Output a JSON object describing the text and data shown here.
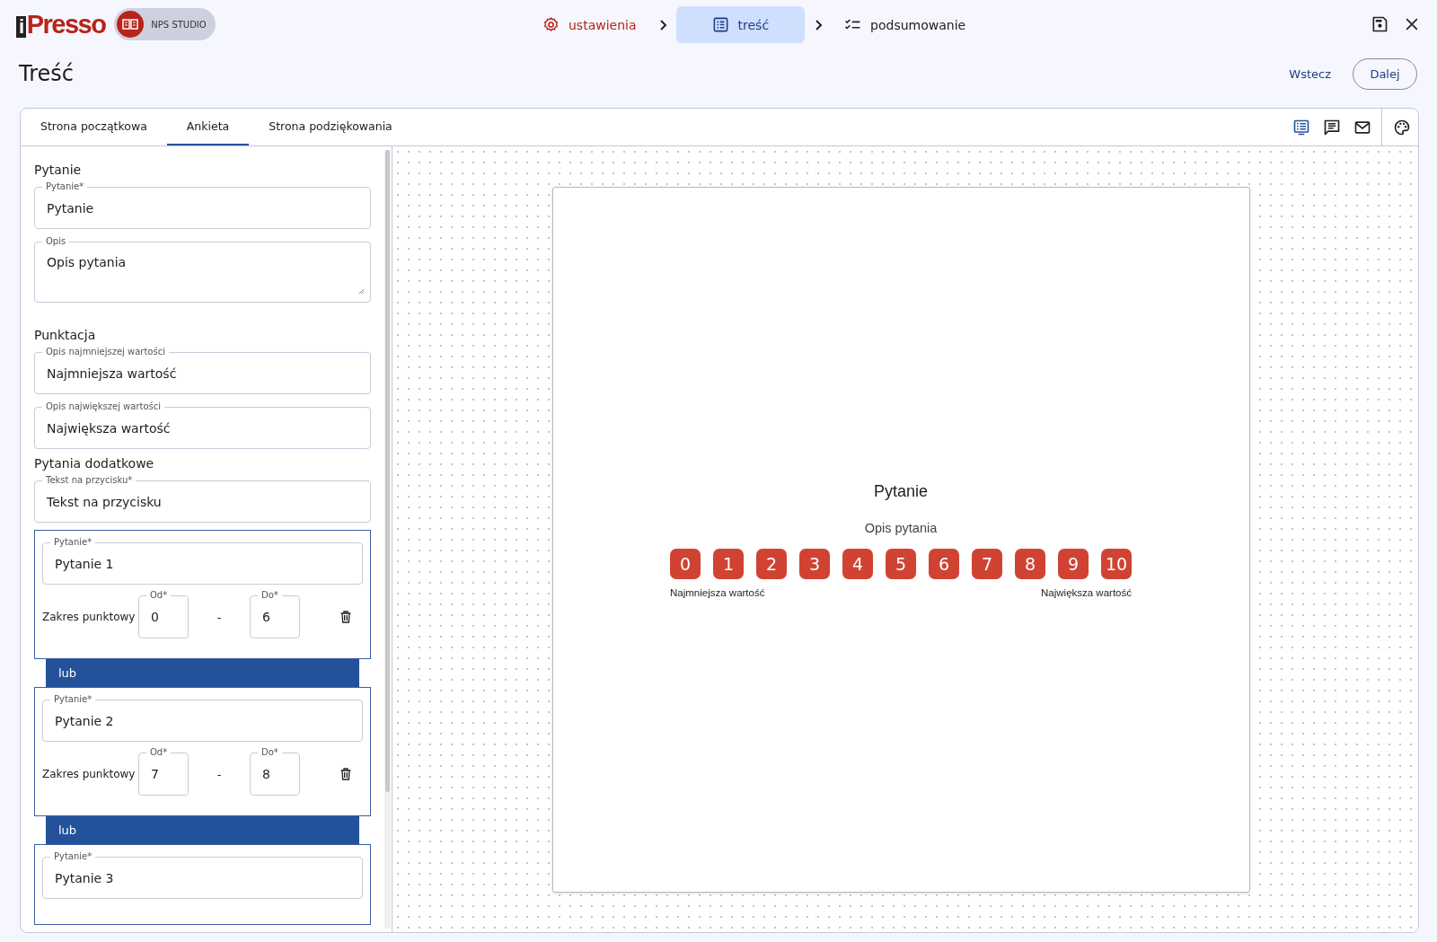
{
  "header": {
    "logo_mark": "i",
    "logo_text": "Presso",
    "badge": "NPS STUDIO",
    "steps": [
      {
        "label": "ustawienia",
        "kind": "settings",
        "selected": false,
        "done": true
      },
      {
        "label": "treść",
        "kind": "list",
        "selected": true,
        "done": false
      },
      {
        "label": "podsumowanie",
        "kind": "checklist",
        "selected": false,
        "done": false
      }
    ]
  },
  "page": {
    "title": "Treść",
    "back": "Wstecz",
    "next": "Dalej"
  },
  "tabs": [
    {
      "label": "Strona początkowa",
      "selected": false
    },
    {
      "label": "Ankieta",
      "selected": true
    },
    {
      "label": "Strona podziękowania",
      "selected": false
    }
  ],
  "toolbar": [
    {
      "kind": "form",
      "selected": true
    },
    {
      "kind": "comment",
      "selected": false
    },
    {
      "kind": "mail",
      "selected": false
    },
    {
      "kind": "palette",
      "selected": false
    }
  ],
  "editor": {
    "sections": [
      {
        "title": "Pytanie",
        "fields": [
          {
            "label": "Pytanie*",
            "value": "Pytanie",
            "kind": "input"
          },
          {
            "label": "Opis",
            "value": "Opis pytania",
            "kind": "textarea"
          }
        ]
      },
      {
        "title": "Punktacja",
        "fields": [
          {
            "label": "Opis najmniejszej wartości",
            "value": "Najmniejsza wartość",
            "kind": "input"
          },
          {
            "label": "Opis największej wartości",
            "value": "Największa wartość",
            "kind": "input"
          }
        ]
      },
      {
        "title": "Pytania dodatkowe",
        "fields": [
          {
            "label": "Tekst na przycisku*",
            "value": "Tekst na przycisku",
            "kind": "input"
          }
        ]
      }
    ],
    "extra_questions": [
      {
        "label": "Pytanie*",
        "value": "Pytanie 1",
        "range_label": "Zakres punktowy",
        "from_label": "Od*",
        "from": "0",
        "dash": "-",
        "to_label": "Do*",
        "to": "6",
        "separator": "lub"
      },
      {
        "label": "Pytanie*",
        "value": "Pytanie 2",
        "range_label": "Zakres punktowy",
        "from_label": "Od*",
        "from": "7",
        "dash": "-",
        "to_label": "Do*",
        "to": "8",
        "separator": "lub"
      },
      {
        "label": "Pytanie*",
        "value": "Pytanie 3"
      }
    ]
  },
  "preview": {
    "title": "Pytanie",
    "description": "Opis pytania",
    "scale": [
      "0",
      "1",
      "2",
      "3",
      "4",
      "5",
      "6",
      "7",
      "8",
      "9",
      "10"
    ],
    "min_label": "Najmniejsza wartość",
    "max_label": "Największa wartość"
  }
}
